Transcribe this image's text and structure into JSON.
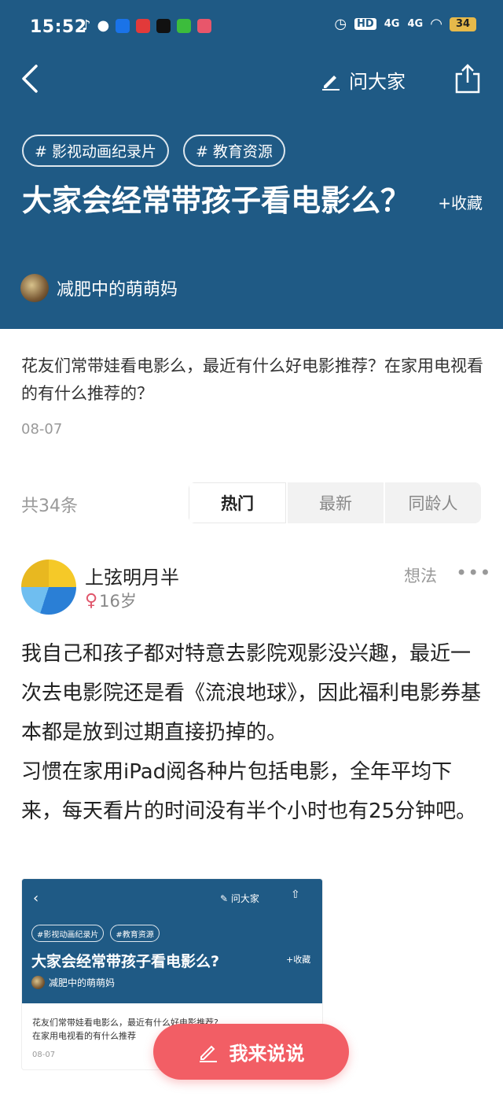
{
  "status": {
    "time": "15:52",
    "hd": "HD",
    "net1": "4G",
    "net2": "4G",
    "battery": "34"
  },
  "nav": {
    "ask_label": "问大家"
  },
  "question": {
    "tags": [
      "# 影视动画纪录片",
      "# 教育资源"
    ],
    "title": "大家会经常带孩子看电影么？",
    "collect_label": "+收藏",
    "author": "减肥中的萌萌妈",
    "text": "花友们常带娃看电影么，最近有什么好电影推荐？在家用电视看的有什么推荐的？",
    "date": "08-07"
  },
  "answers_bar": {
    "count": "共34条",
    "tabs": [
      "热门",
      "最新",
      "同龄人"
    ]
  },
  "answer": {
    "name": "上弦明月半",
    "gender_symbol": "♀",
    "age": "16岁",
    "type": "想法",
    "more": "•••",
    "paragraph1": "我自己和孩子都对特意去影院观影没兴趣，最近一次去电影院还是看《流浪地球》，因此福利电影券基本都是放到过期直接扔掉的。",
    "paragraph2": "习惯在家用iPad阅各种片包括电影，全年平均下来，每天看片的时间没有半个小时也有25分钟吧。"
  },
  "embed": {
    "ask_label": "问大家",
    "tags": [
      "#影视动画纪录片",
      "#教育资源"
    ],
    "title": "大家会经常带孩子看电影么?",
    "collect_label": "+收藏",
    "author": "减肥中的萌萌妈",
    "q_line1": "花友们常带娃看电影么，最近有什么好电影推荐?",
    "q_line2": "在家用电视看的有什么推荐",
    "date": "08-07"
  },
  "fab": {
    "label": "我来说说"
  },
  "colors": {
    "header_bg": "#1f5a85",
    "accent": "#f25e65"
  }
}
